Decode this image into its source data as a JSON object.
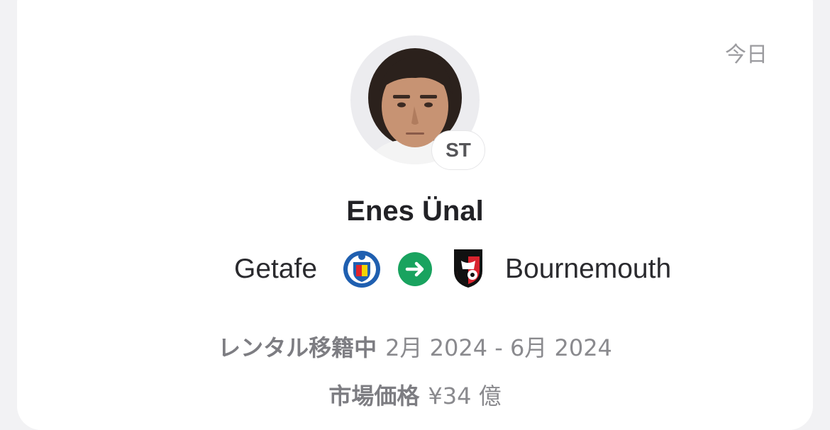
{
  "card": {
    "date_label": "今日",
    "position": "ST",
    "player_name": "Enes Ünal",
    "from_club": "Getafe",
    "to_club": "Bournemouth",
    "loan_label": "レンタル移籍中",
    "loan_period": "2月 2024 - 6月 2024",
    "value_label": "市場価格",
    "value_amount": "¥34 億"
  },
  "icons": {
    "from_crest": "getafe-crest-icon",
    "arrow": "arrow-right-icon",
    "to_crest": "bournemouth-crest-icon",
    "avatar": "player-photo"
  },
  "colors": {
    "arrow_bg": "#19a35f",
    "getafe_blue": "#1f5fb0",
    "bournemouth_red": "#d9232e"
  }
}
